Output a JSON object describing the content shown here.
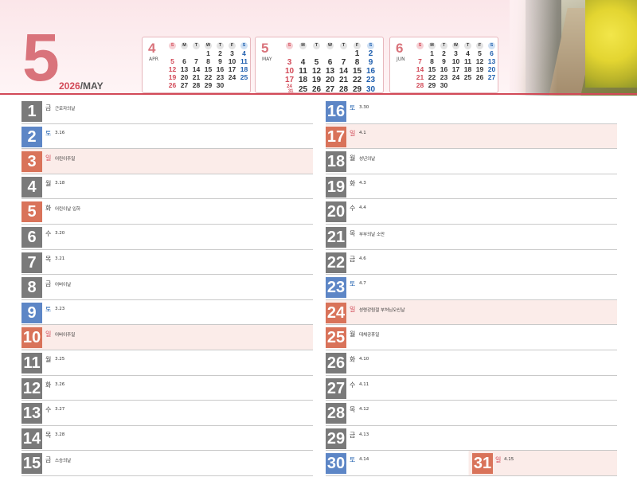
{
  "header": {
    "month_number": "5",
    "year": "2026",
    "separator": "/",
    "month_name": "MAY"
  },
  "mini_calendars": [
    {
      "number": "4",
      "abbr": "APR",
      "weekdays": [
        "S",
        "M",
        "T",
        "W",
        "T",
        "F",
        "S"
      ],
      "weeks": [
        [
          "",
          "",
          "",
          "1",
          "2",
          "3",
          "4"
        ],
        [
          "5",
          "6",
          "7",
          "8",
          "9",
          "10",
          "11"
        ],
        [
          "12",
          "13",
          "14",
          "15",
          "16",
          "17",
          "18"
        ],
        [
          "19",
          "20",
          "21",
          "22",
          "23",
          "24",
          "25"
        ],
        [
          "26",
          "27",
          "28",
          "29",
          "30",
          "",
          ""
        ]
      ]
    },
    {
      "number": "5",
      "abbr": "MAY",
      "weekdays": [
        "S",
        "M",
        "T",
        "W",
        "T",
        "F",
        "S"
      ],
      "weeks": [
        [
          "",
          "",
          "",
          "",
          "",
          "1",
          "2"
        ],
        [
          "3",
          "4",
          "5",
          "6",
          "7",
          "8",
          "9"
        ],
        [
          "10",
          "11",
          "12",
          "13",
          "14",
          "15",
          "16"
        ],
        [
          "17",
          "18",
          "19",
          "20",
          "21",
          "22",
          "23"
        ],
        [
          "24/31",
          "25",
          "26",
          "27",
          "28",
          "29",
          "30"
        ]
      ]
    },
    {
      "number": "6",
      "abbr": "JUN",
      "weekdays": [
        "S",
        "M",
        "T",
        "W",
        "T",
        "F",
        "S"
      ],
      "weeks": [
        [
          "",
          "1",
          "2",
          "3",
          "4",
          "5",
          "6"
        ],
        [
          "7",
          "8",
          "9",
          "10",
          "11",
          "12",
          "13"
        ],
        [
          "14",
          "15",
          "16",
          "17",
          "18",
          "19",
          "20"
        ],
        [
          "21",
          "22",
          "23",
          "24",
          "25",
          "26",
          "27"
        ],
        [
          "28",
          "29",
          "30",
          "",
          "",
          "",
          ""
        ]
      ]
    }
  ],
  "days_left": [
    {
      "day": "1",
      "weekday": "금",
      "note": "근로자의날",
      "kind": "normal",
      "holiday": false
    },
    {
      "day": "2",
      "weekday": "토",
      "note": "3.16",
      "kind": "sat",
      "holiday": false
    },
    {
      "day": "3",
      "weekday": "일",
      "note": "어린이주일",
      "kind": "sun",
      "holiday": true
    },
    {
      "day": "4",
      "weekday": "월",
      "note": "3.18",
      "kind": "normal",
      "holiday": false
    },
    {
      "day": "5",
      "weekday": "화",
      "note": "어린이날 입하",
      "kind": "sun",
      "holiday": false
    },
    {
      "day": "6",
      "weekday": "수",
      "note": "3.20",
      "kind": "normal",
      "holiday": false
    },
    {
      "day": "7",
      "weekday": "목",
      "note": "3.21",
      "kind": "normal",
      "holiday": false
    },
    {
      "day": "8",
      "weekday": "금",
      "note": "어버이날",
      "kind": "normal",
      "holiday": false
    },
    {
      "day": "9",
      "weekday": "토",
      "note": "3.23",
      "kind": "sat",
      "holiday": false
    },
    {
      "day": "10",
      "weekday": "일",
      "note": "어버이주일",
      "kind": "sun",
      "holiday": true
    },
    {
      "day": "11",
      "weekday": "월",
      "note": "3.25",
      "kind": "normal",
      "holiday": false
    },
    {
      "day": "12",
      "weekday": "화",
      "note": "3.26",
      "kind": "normal",
      "holiday": false
    },
    {
      "day": "13",
      "weekday": "수",
      "note": "3.27",
      "kind": "normal",
      "holiday": false
    },
    {
      "day": "14",
      "weekday": "목",
      "note": "3.28",
      "kind": "normal",
      "holiday": false
    },
    {
      "day": "15",
      "weekday": "금",
      "note": "스승의날",
      "kind": "normal",
      "holiday": false
    }
  ],
  "days_right": [
    {
      "day": "16",
      "weekday": "토",
      "note": "3.30",
      "kind": "sat",
      "holiday": false
    },
    {
      "day": "17",
      "weekday": "일",
      "note": "4.1",
      "kind": "sun",
      "holiday": true
    },
    {
      "day": "18",
      "weekday": "월",
      "note": "성년의날",
      "kind": "normal",
      "holiday": false
    },
    {
      "day": "19",
      "weekday": "화",
      "note": "4.3",
      "kind": "normal",
      "holiday": false
    },
    {
      "day": "20",
      "weekday": "수",
      "note": "4.4",
      "kind": "normal",
      "holiday": false
    },
    {
      "day": "21",
      "weekday": "목",
      "note": "부부의날 소만",
      "kind": "normal",
      "holiday": false
    },
    {
      "day": "22",
      "weekday": "금",
      "note": "4.6",
      "kind": "normal",
      "holiday": false
    },
    {
      "day": "23",
      "weekday": "토",
      "note": "4.7",
      "kind": "sat",
      "holiday": false
    },
    {
      "day": "24",
      "weekday": "일",
      "note": "성령강림절 부처님오신날",
      "kind": "sun",
      "holiday": true
    },
    {
      "day": "25",
      "weekday": "월",
      "note": "대체공휴일",
      "kind": "sun",
      "holiday": false
    },
    {
      "day": "26",
      "weekday": "화",
      "note": "4.10",
      "kind": "normal",
      "holiday": false
    },
    {
      "day": "27",
      "weekday": "수",
      "note": "4.11",
      "kind": "normal",
      "holiday": false
    },
    {
      "day": "28",
      "weekday": "목",
      "note": "4.12",
      "kind": "normal",
      "holiday": false
    },
    {
      "day": "29",
      "weekday": "금",
      "note": "4.13",
      "kind": "normal",
      "holiday": false
    },
    {
      "day": "30",
      "weekday": "토",
      "note": "4.14",
      "kind": "sat",
      "holiday": false
    }
  ],
  "day31": {
    "day": "31",
    "weekday": "일",
    "note": "4.15",
    "kind": "sun"
  },
  "colors": {
    "accent": "#d24a58",
    "saturday": "#5d86c6",
    "sunday": "#d9735a",
    "weekday": "#7a7a7a"
  }
}
